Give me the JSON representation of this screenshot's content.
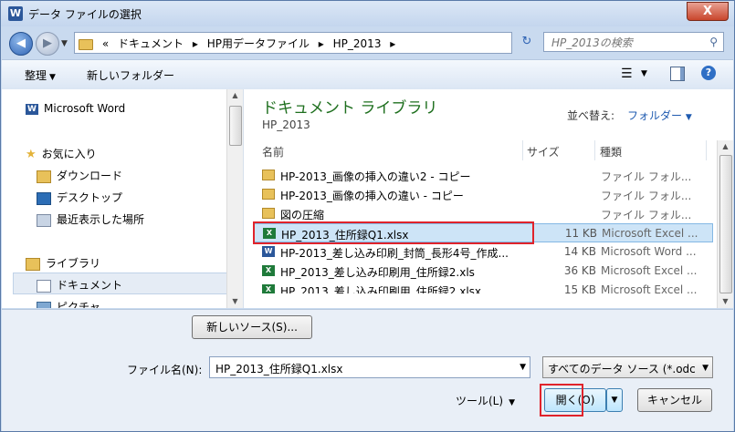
{
  "window": {
    "title": "データ ファイルの選択",
    "close_glyph": "X",
    "app_glyph": "W"
  },
  "address": {
    "crumbs": [
      "«",
      "ドキュメント",
      "▸",
      "HP用データファイル",
      "▸",
      "HP_2013",
      "▸"
    ],
    "search_placeholder": "HP_2013の検索"
  },
  "toolbar": {
    "organize": "整理",
    "new_folder": "新しいフォルダー"
  },
  "nav": {
    "items": [
      {
        "label": "Microsoft Word"
      },
      {
        "label": "お気に入り"
      },
      {
        "label": "ダウンロード"
      },
      {
        "label": "デスクトップ"
      },
      {
        "label": "最近表示した場所"
      },
      {
        "label": "ライブラリ"
      },
      {
        "label": "ドキュメント"
      },
      {
        "label": "ピクチャ"
      }
    ]
  },
  "library": {
    "title": "ドキュメント ライブラリ",
    "subtitle": "HP_2013",
    "sort_label": "並べ替え:",
    "sort_value": "フォルダー"
  },
  "columns": {
    "name": "名前",
    "size": "サイズ",
    "type": "種類"
  },
  "files": [
    {
      "name": "HP-2013_画像の挿入の違い2 - コピー",
      "size": "",
      "type": "ファイル フォル...",
      "icon": "folder-icon"
    },
    {
      "name": "HP-2013_画像の挿入の違い - コピー",
      "size": "",
      "type": "ファイル フォル...",
      "icon": "folder-icon"
    },
    {
      "name": "図の圧縮",
      "size": "",
      "type": "ファイル フォル...",
      "icon": "folder-icon"
    },
    {
      "name": "HP_2013_住所録Q1.xlsx",
      "size": "11 KB",
      "type": "Microsoft Excel ...",
      "icon": "excel-file-icon"
    },
    {
      "name": "HP-2013_差し込み印刷_封筒_長形4号_作成...",
      "size": "14 KB",
      "type": "Microsoft Word ...",
      "icon": "word-file-icon"
    },
    {
      "name": "HP_2013_差し込み印刷用_住所録2.xls",
      "size": "36 KB",
      "type": "Microsoft Excel ...",
      "icon": "excel-file-icon"
    },
    {
      "name": "HP_2013_差し込み印刷用_住所録2.xlsx",
      "size": "15 KB",
      "type": "Microsoft Excel ...",
      "icon": "excel-file-icon"
    }
  ],
  "bottom": {
    "new_source": "新しいソース(S)...",
    "filename_label": "ファイル名(N):",
    "filename_value": "HP_2013_住所録Q1.xlsx",
    "filetype_value": "すべてのデータ ソース (*.odc",
    "tools": "ツール(L)",
    "open": "開く(O)",
    "cancel": "キャンセル"
  },
  "colors": {
    "accent_red": "#e0232b",
    "library_green": "#1e6f1e",
    "link_blue": "#1f5bb0"
  }
}
